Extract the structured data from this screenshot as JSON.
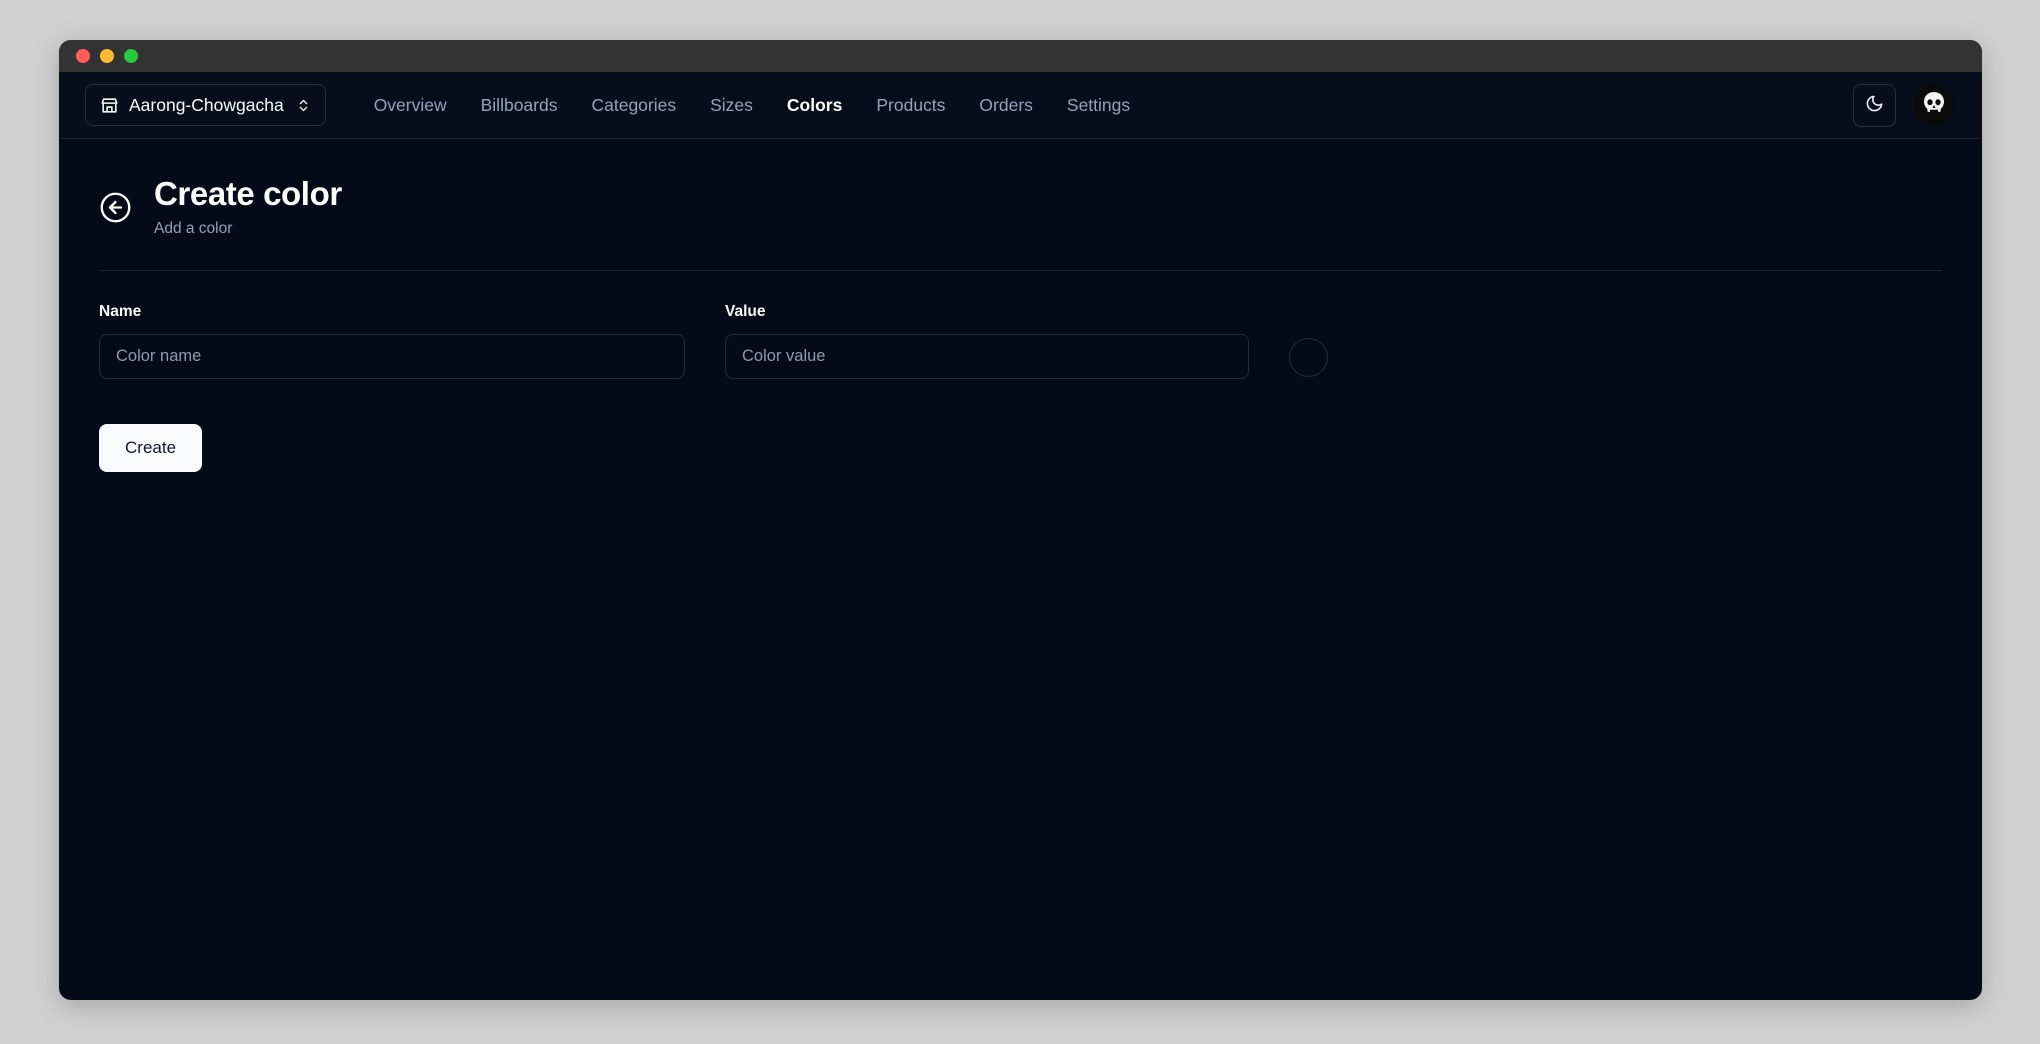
{
  "window": {
    "traffic_lights": [
      "close",
      "minimize",
      "maximize"
    ]
  },
  "navbar": {
    "store_switcher": {
      "label": "Aarong-Chowgacha",
      "icon": "store-icon",
      "chevron_icon": "chevrons-up-down-icon"
    },
    "links": [
      {
        "label": "Overview",
        "active": false
      },
      {
        "label": "Billboards",
        "active": false
      },
      {
        "label": "Categories",
        "active": false
      },
      {
        "label": "Sizes",
        "active": false
      },
      {
        "label": "Colors",
        "active": true
      },
      {
        "label": "Products",
        "active": false
      },
      {
        "label": "Orders",
        "active": false
      },
      {
        "label": "Settings",
        "active": false
      }
    ],
    "theme_toggle": {
      "icon": "moon-icon",
      "label": "Toggle theme"
    },
    "avatar": {
      "icon": "skull-avatar",
      "label": "User menu"
    }
  },
  "page": {
    "back_button_icon": "arrow-left-circle-icon",
    "title": "Create color",
    "subtitle": "Add a color"
  },
  "form": {
    "name_field": {
      "label": "Name",
      "placeholder": "Color name",
      "value": ""
    },
    "value_field": {
      "label": "Value",
      "placeholder": "Color value",
      "value": ""
    },
    "color_preview": {
      "value": ""
    },
    "submit_label": "Create"
  },
  "colors": {
    "app_background": "#040a17",
    "navbar_background": "#060d1b",
    "desktop_background": "#d1d1d1",
    "titlebar": "#333333",
    "accent_text": "#ffffff",
    "muted_text": "#94a3b8",
    "border": "#252e3d",
    "button_background": "#f8fafc",
    "button_text": "#0f172a",
    "traffic_red": "#ff5f57",
    "traffic_yellow": "#febc2e",
    "traffic_green": "#28c840"
  }
}
